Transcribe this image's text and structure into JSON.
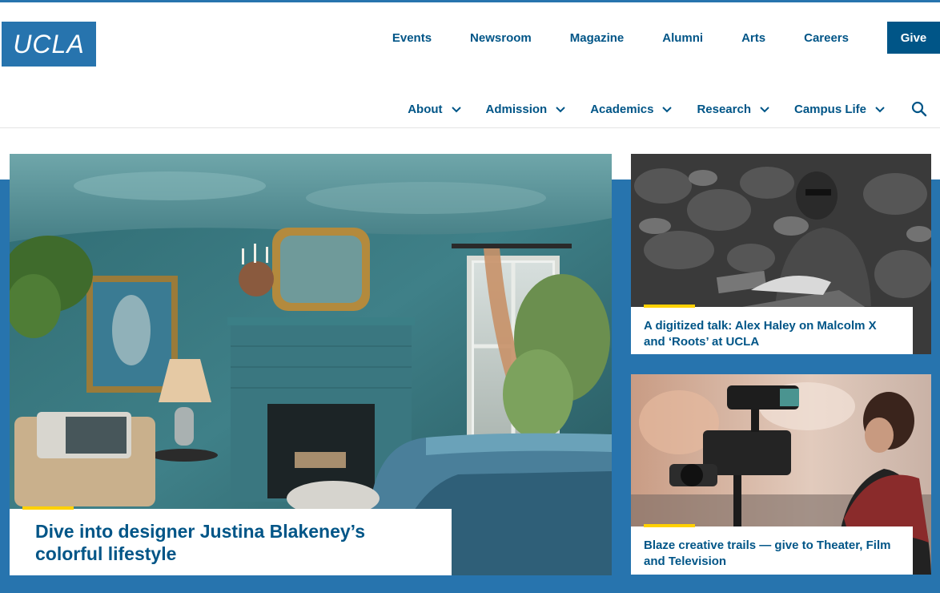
{
  "logo": {
    "text": "UCLA"
  },
  "utility_nav": [
    {
      "label": "Events"
    },
    {
      "label": "Newsroom"
    },
    {
      "label": "Magazine"
    },
    {
      "label": "Alumni"
    },
    {
      "label": "Arts"
    },
    {
      "label": "Careers"
    }
  ],
  "give": {
    "label": "Give"
  },
  "main_nav": [
    {
      "label": "About",
      "icon": "chevron-down-icon"
    },
    {
      "label": "Admission",
      "icon": "chevron-down-icon"
    },
    {
      "label": "Academics",
      "icon": "chevron-down-icon"
    },
    {
      "label": "Research",
      "icon": "chevron-down-icon"
    },
    {
      "label": "Campus Life",
      "icon": "chevron-down-icon"
    }
  ],
  "search": {
    "icon": "search-icon"
  },
  "hero": {
    "title": "Dive into designer Justina Blakeney’s colorful lifestyle"
  },
  "cards": [
    {
      "title": "A digitized talk: Alex Haley on Malcolm X and ‘Roots’ at UCLA"
    },
    {
      "title": "Blaze creative trails — give to Theater, Film and Television"
    }
  ],
  "colors": {
    "ucla_blue": "#2774ae",
    "darker_blue": "#005587",
    "gold": "#ffd100"
  }
}
